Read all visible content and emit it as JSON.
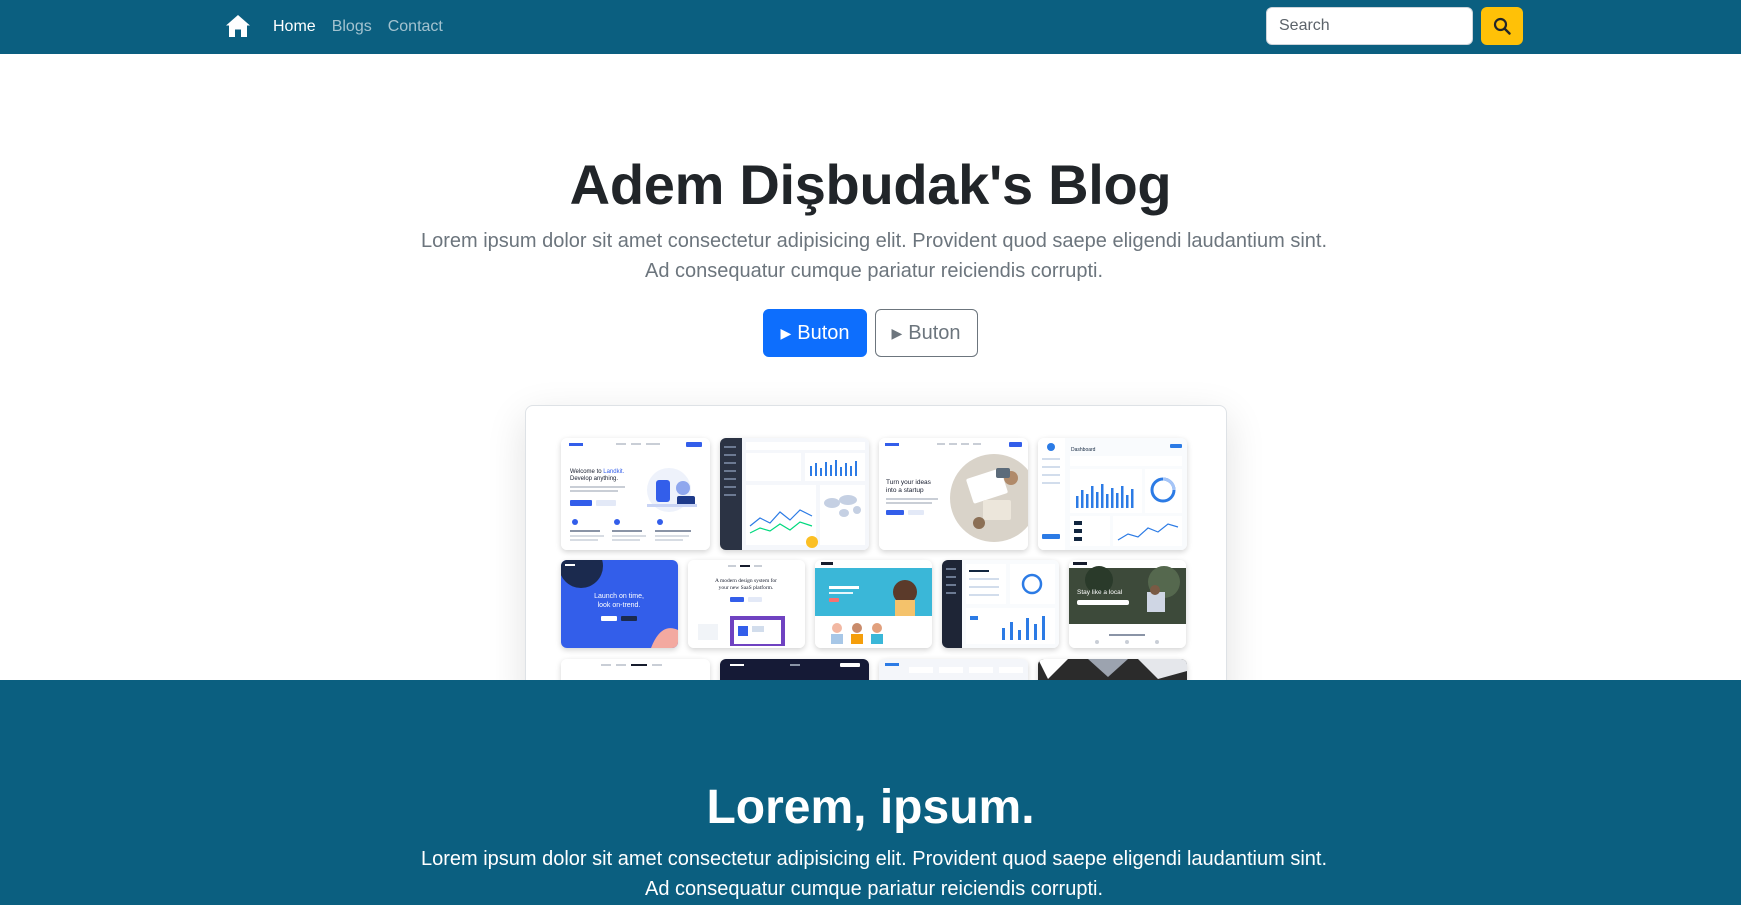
{
  "navbar": {
    "home_icon": "house-icon",
    "links": [
      {
        "label": "Home",
        "active": true
      },
      {
        "label": "Blogs",
        "active": false
      },
      {
        "label": "Contact",
        "active": false
      }
    ],
    "search": {
      "placeholder": "Search",
      "button_icon": "search-icon"
    },
    "colors": {
      "background": "#0b5f80",
      "search_button": "#ffc107"
    }
  },
  "hero": {
    "title": "Adem Dişbudak's Blog",
    "lead": "Lorem ipsum dolor sit amet consectetur adipisicing elit. Provident quod saepe eligendi laudantium sint. Ad consequatur cumque pariatur reiciendis corrupti.",
    "primary_button": {
      "icon": "play-icon",
      "label": "Buton"
    },
    "secondary_button": {
      "icon": "play-icon",
      "label": "Buton"
    },
    "preview": {
      "thumbnails": [
        {
          "title": "Welcome to Landkit. Develop anything.",
          "theme": "light"
        },
        {
          "theme": "dark-dashboard"
        },
        {
          "title": "Turn your ideas into a startup",
          "theme": "light-photo"
        },
        {
          "title": "Dashboard",
          "theme": "light-dashboard"
        },
        {
          "title": "Launch on time, look on-trend.",
          "theme": "blue"
        },
        {
          "title": "A modern design system for your new SaaS platform.",
          "theme": "light"
        },
        {
          "theme": "teal-photo"
        },
        {
          "theme": "dark-dashboard"
        },
        {
          "title": "Stay like a local",
          "theme": "photo"
        }
      ]
    }
  },
  "section2": {
    "title": "Lorem, ipsum.",
    "lead": "Lorem ipsum dolor sit amet consectetur adipisicing elit. Provident quod saepe eligendi laudantium sint. Ad consequatur cumque pariatur reiciendis corrupti."
  }
}
